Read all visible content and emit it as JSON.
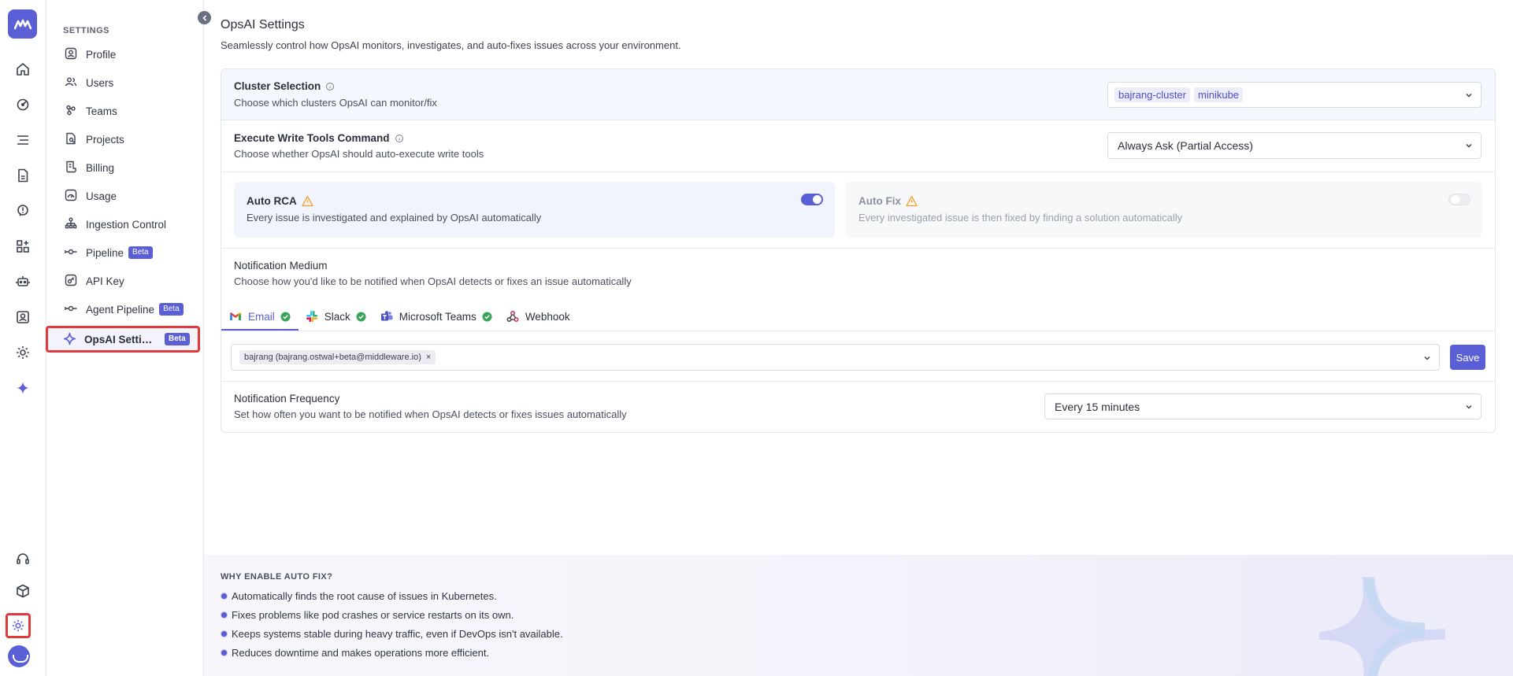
{
  "colors": {
    "accent": "#5b5fd6",
    "highlight_border": "#e23a3a",
    "warning": "#f0a020",
    "success": "#3aa55a"
  },
  "rail": {
    "logo_icon": "middleware-logo-icon",
    "icons": [
      "home-icon",
      "dashboard-icon",
      "list-icon",
      "document-icon",
      "alerts-icon",
      "widgets-icon",
      "robot-icon",
      "user-check-icon",
      "settings-cog-icon",
      "sparkle-icon"
    ],
    "bottom_icons": [
      "headset-icon",
      "package-icon",
      "settings-icon",
      "avatar"
    ]
  },
  "sidebar": {
    "title": "SETTINGS",
    "items": [
      {
        "label": "Profile",
        "icon": "user-circle-icon"
      },
      {
        "label": "Users",
        "icon": "users-icon"
      },
      {
        "label": "Teams",
        "icon": "teams-icon"
      },
      {
        "label": "Projects",
        "icon": "projects-icon"
      },
      {
        "label": "Billing",
        "icon": "billing-icon"
      },
      {
        "label": "Usage",
        "icon": "usage-icon"
      },
      {
        "label": "Ingestion Control",
        "icon": "ingestion-icon"
      },
      {
        "label": "Pipeline",
        "icon": "pipeline-icon",
        "badge": "Beta"
      },
      {
        "label": "API Key",
        "icon": "key-icon"
      },
      {
        "label": "Agent Pipeline",
        "icon": "pipeline-icon",
        "badge": "Beta"
      }
    ],
    "active": {
      "label": "OpsAI Settings",
      "icon": "sparkle-icon",
      "badge": "Beta"
    }
  },
  "page": {
    "title": "OpsAI Settings",
    "subtitle": "Seamlessly control how OpsAI monitors, investigates, and auto-fixes issues across your environment."
  },
  "cluster": {
    "title": "Cluster Selection",
    "desc": "Choose which clusters OpsAI can monitor/fix",
    "chips": [
      "bajrang-cluster",
      "minikube"
    ]
  },
  "write_tools": {
    "title": "Execute Write Tools Command",
    "desc": "Choose whether OpsAI should auto-execute write tools",
    "value": "Always Ask (Partial Access)"
  },
  "auto_rca": {
    "title": "Auto RCA",
    "desc": "Every issue is investigated and explained by OpsAI automatically",
    "enabled": true
  },
  "auto_fix": {
    "title": "Auto Fix",
    "desc": "Every investigated issue is then fixed by finding a solution automatically",
    "enabled": false
  },
  "notification_medium": {
    "title": "Notification Medium",
    "desc": "Choose how you'd like to be notified when OpsAI detects or fixes an issue automatically",
    "tabs": [
      {
        "label": "Email",
        "icon": "gmail-icon",
        "connected": true
      },
      {
        "label": "Slack",
        "icon": "slack-icon",
        "connected": true
      },
      {
        "label": "Microsoft Teams",
        "icon": "ms-teams-icon",
        "connected": true
      },
      {
        "label": "Webhook",
        "icon": "webhook-icon",
        "connected": false
      }
    ],
    "active_tab": "Email",
    "recipients": [
      "bajrang (bajrang.ostwal+beta@middleware.io)"
    ],
    "save_label": "Save"
  },
  "notification_frequency": {
    "title": "Notification Frequency",
    "desc": "Set how often you want to be notified when OpsAI detects or fixes issues automatically",
    "value": "Every 15 minutes"
  },
  "promo": {
    "title": "WHY ENABLE AUTO FIX?",
    "points": [
      "Automatically finds the root cause of issues in Kubernetes.",
      "Fixes problems like pod crashes or service restarts on its own.",
      "Keeps systems stable during heavy traffic, even if DevOps isn't available.",
      "Reduces downtime and makes operations more efficient."
    ]
  }
}
